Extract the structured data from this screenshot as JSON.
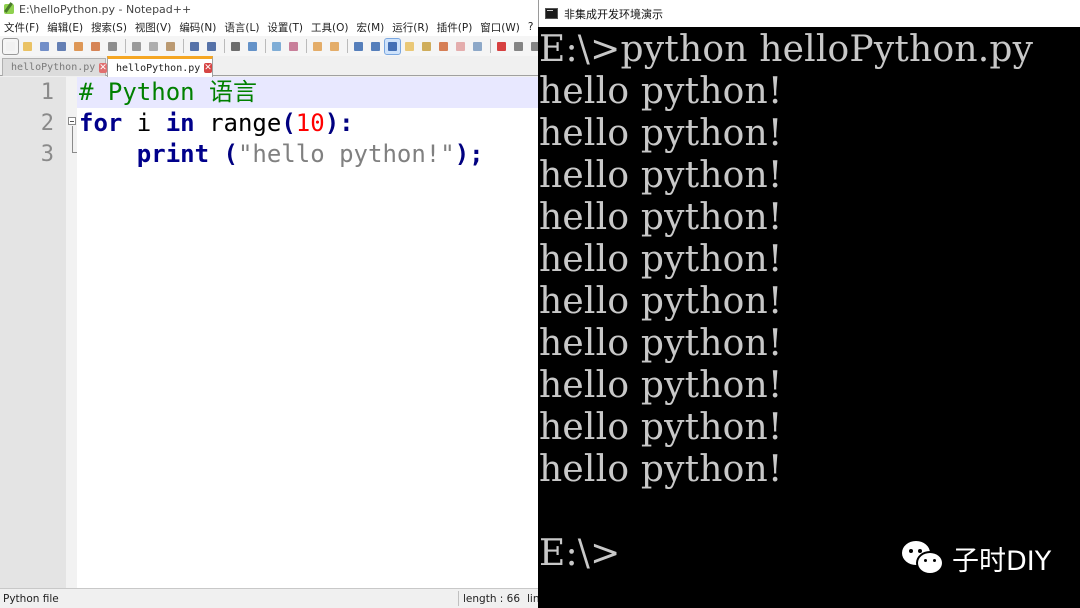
{
  "notepad": {
    "title": "E:\\helloPython.py - Notepad++",
    "menu": [
      "文件(F)",
      "编辑(E)",
      "搜索(S)",
      "视图(V)",
      "编码(N)",
      "语言(L)",
      "设置(T)",
      "工具(O)",
      "宏(M)",
      "运行(R)",
      "插件(P)",
      "窗口(W)",
      "?"
    ],
    "tabs": [
      {
        "label": "helloPython.py",
        "active": false
      },
      {
        "label": "helloPython.py",
        "active": true
      }
    ],
    "line_numbers": [
      "1",
      "2",
      "3"
    ],
    "code": {
      "l1": "# Python 语言",
      "l2_kw1": "for",
      "l2_var": " i ",
      "l2_kw2": "in",
      "l2_fn": " range",
      "l2_p1": "(",
      "l2_num": "10",
      "l2_p2": "):",
      "l3_indent": "    ",
      "l3_kw": "print",
      "l3_sp": " ",
      "l3_p1": "(",
      "l3_str": "\"hello python!\"",
      "l3_p2": ");"
    },
    "status": {
      "filetype": "Python file",
      "length": "length : 66",
      "lines": "lin"
    },
    "toolbar_icons": [
      "new-file-icon",
      "open-icon",
      "save-icon",
      "save-all-icon",
      "close-icon",
      "close-all-icon",
      "print-icon",
      "cut-icon",
      "copy-icon",
      "paste-icon",
      "undo-icon",
      "redo-icon",
      "find-icon",
      "replace-icon",
      "zoom-in-icon",
      "zoom-out-icon",
      "sync-v-icon",
      "sync-h-icon",
      "wrap-icon",
      "show-all-chars-icon",
      "indent-guide-icon",
      "doc-map-icon",
      "function-list-icon",
      "folder-icon",
      "monitor-icon",
      "record-macro-icon",
      "stop-macro-icon",
      "play-macro-icon"
    ]
  },
  "console": {
    "title": "非集成开发环境演示",
    "lines": [
      "E:\\>python helloPython.py",
      "hello python!",
      "hello python!",
      "hello python!",
      "hello python!",
      "hello python!",
      "hello python!",
      "hello python!",
      "hello python!",
      "hello python!",
      "hello python!",
      "",
      "E:\\>"
    ]
  },
  "watermark": {
    "text": "子时DIY",
    "icon": "wechat-icon"
  }
}
